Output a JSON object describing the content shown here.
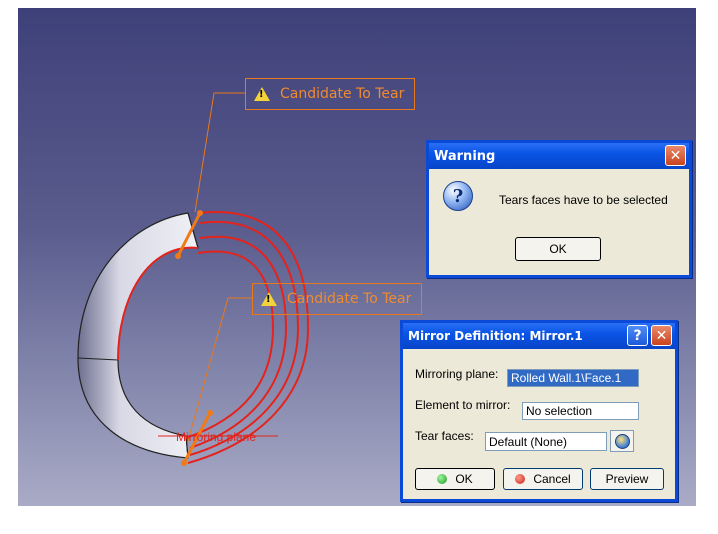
{
  "viewport": {
    "callout_top": "Candidate To Tear",
    "callout_bottom": "Candidate To Tear",
    "plane_label": "Mirroring plane"
  },
  "warning_dialog": {
    "title": "Warning",
    "message": "Tears faces have to be selected",
    "ok_label": "OK",
    "icon": "question-icon",
    "close_icon": "close-icon"
  },
  "mirror_dialog": {
    "title": "Mirror Definition: Mirror.1",
    "mirroring_plane_label": "Mirroring plane:",
    "mirroring_plane_value": "Rolled Wall.1\\Face.1",
    "element_label": "Element to mirror:",
    "element_value": "No selection",
    "tear_faces_label": "Tear faces:",
    "tear_faces_value": "Default (None)",
    "ok_label": "OK",
    "cancel_label": "Cancel",
    "preview_label": "Preview",
    "help_icon": "help-icon",
    "close_icon": "close-icon"
  },
  "colors": {
    "callout": "#f08a2e",
    "geometry_red": "#e4231c",
    "title_bar": "#0a55e6",
    "dialog_bg": "#ece9d8"
  }
}
